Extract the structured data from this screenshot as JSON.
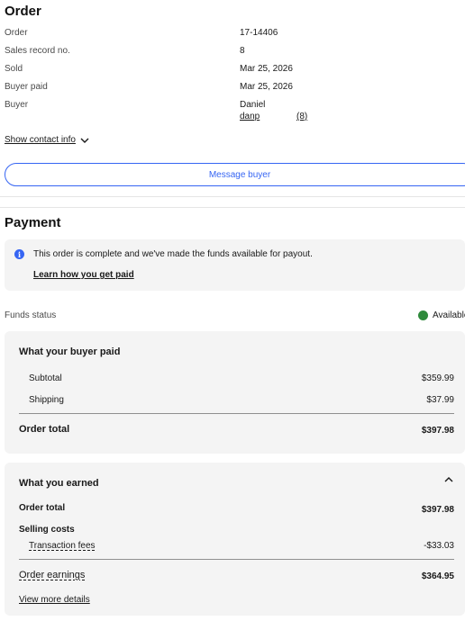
{
  "order": {
    "heading": "Order",
    "rows": [
      {
        "label": "Order",
        "value": "17-14406"
      },
      {
        "label": "Sales record no.",
        "value": "8"
      },
      {
        "label": "Sold",
        "value": "Mar 25, 2026"
      },
      {
        "label": "Buyer paid",
        "value": "Mar 25, 2026"
      },
      {
        "label": "Buyer",
        "value": "Daniel"
      }
    ],
    "buyer_username": "danp",
    "buyer_feedback": "(8)",
    "show_contact_label": "Show contact info",
    "message_button_label": "Message buyer"
  },
  "payment": {
    "heading": "Payment",
    "notice_text": "This order is complete and we've made the funds available for payout.",
    "learn_link": "Learn how you get paid",
    "funds_status_label": "Funds status",
    "funds_status_value": "Available",
    "status_color": "#2f8a3c"
  },
  "buyer_paid": {
    "title": "What your buyer paid",
    "subtotal_label": "Subtotal",
    "subtotal_value": "$359.99",
    "shipping_label": "Shipping",
    "shipping_value": "$37.99",
    "total_label": "Order total",
    "total_value": "$397.98"
  },
  "earned": {
    "title": "What you earned",
    "order_total_label": "Order total",
    "order_total_value": "$397.98",
    "selling_costs_label": "Selling costs",
    "transaction_fees_label": "Transaction fees",
    "transaction_fees_value": "-$33.03",
    "earnings_label": "Order earnings",
    "earnings_value": "$364.95",
    "view_more_link": "View more details"
  },
  "colors": {
    "accent": "#3665f3",
    "card_bg": "#f4f4f4"
  }
}
